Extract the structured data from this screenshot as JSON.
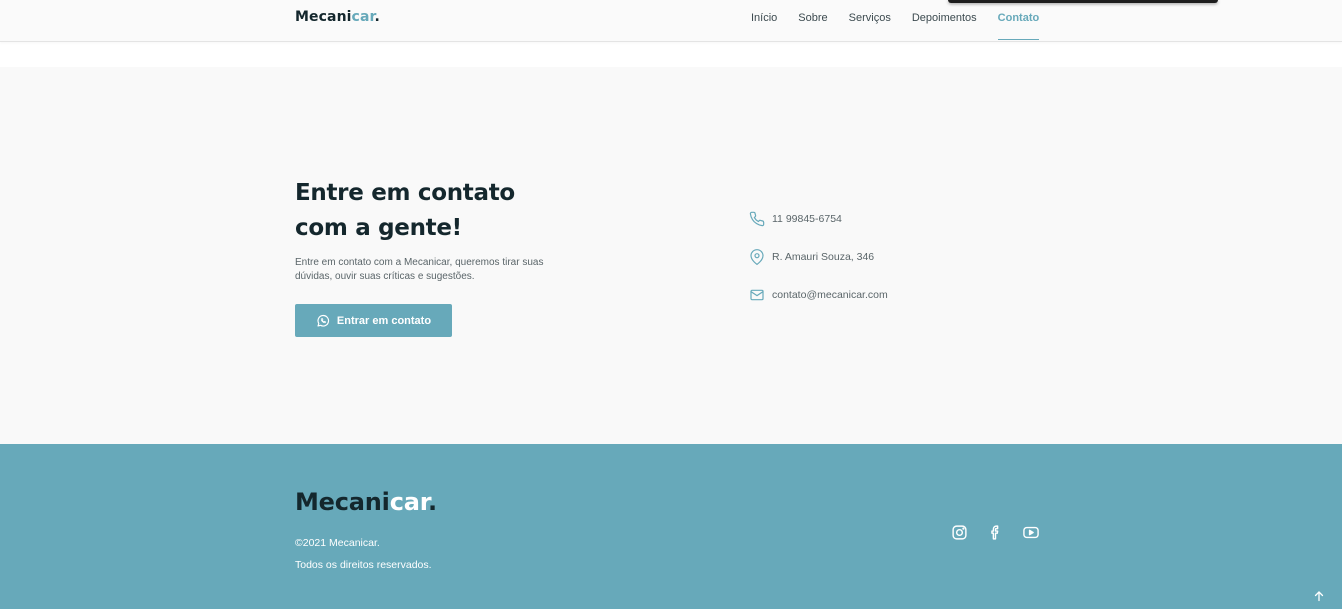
{
  "brand": {
    "name_prefix": "Mecani",
    "name_accent": "car",
    "name_dot": "."
  },
  "nav": {
    "items": [
      {
        "label": "Início"
      },
      {
        "label": "Sobre"
      },
      {
        "label": "Serviços"
      },
      {
        "label": "Depoimentos"
      },
      {
        "label": "Contato"
      }
    ],
    "active_label": "Contato"
  },
  "contact": {
    "title_line1": "Entre em contato",
    "title_line2": "com a gente!",
    "description": "Entre em contato com a Mecanicar, queremos tirar suas dúvidas, ouvir suas críticas e sugestões.",
    "button_label": "Entrar em contato",
    "button_icon": "whatsapp-icon",
    "info": {
      "phone": "11 99845-6754",
      "address": "R. Amauri Souza, 346",
      "email": "contato@mecanicar.com"
    }
  },
  "footer": {
    "copyright": "©2021 Mecanicar.",
    "rights": "Todos os direitos reservados.",
    "social_icons": [
      "instagram-icon",
      "facebook-icon",
      "youtube-icon"
    ],
    "scroll_top_icon": "arrow-up-icon"
  },
  "colors": {
    "accent": "#67a9ba",
    "dark": "#14272d",
    "text_muted": "#5a6569",
    "section_bg": "#f9f9f9"
  }
}
